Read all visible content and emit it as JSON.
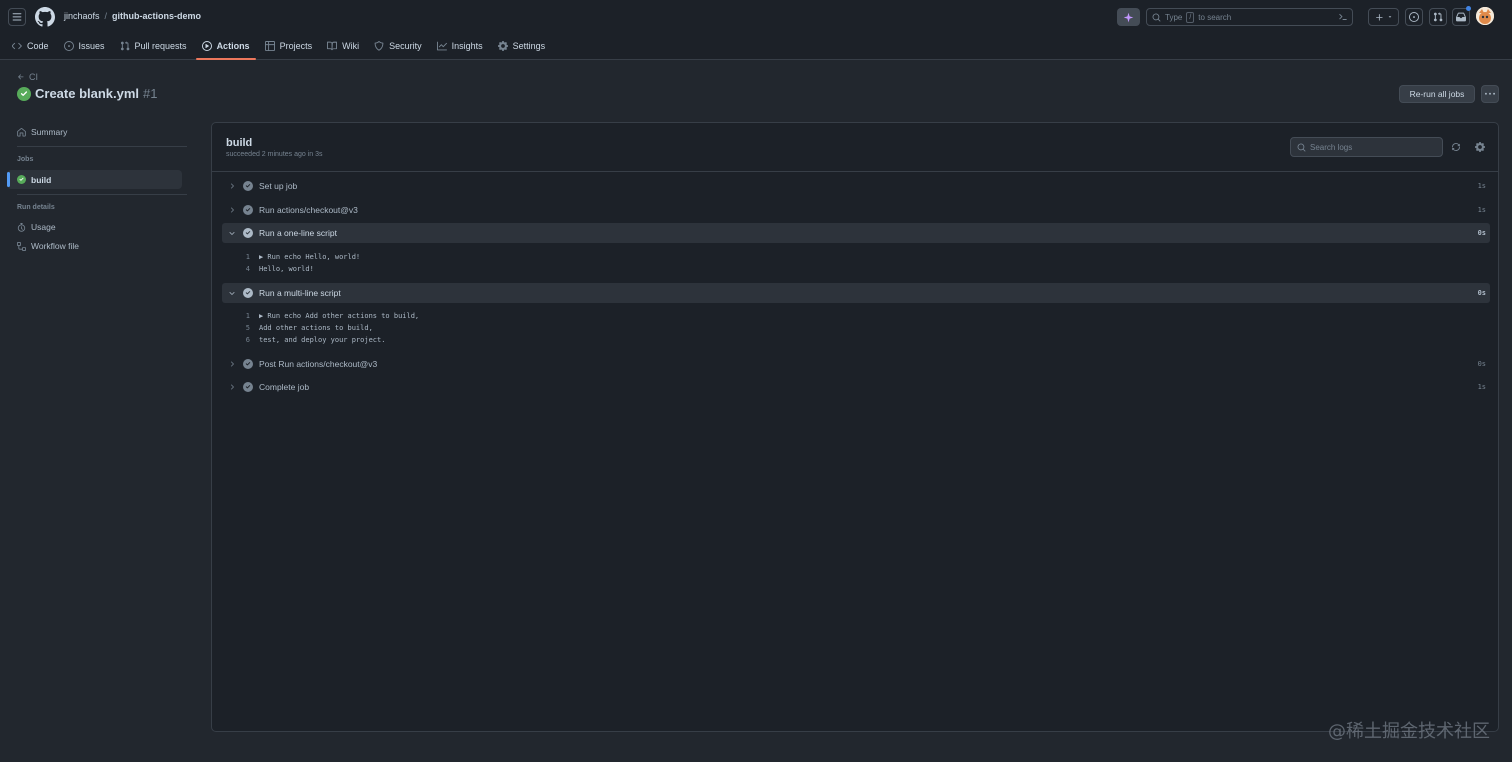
{
  "header": {
    "owner": "jinchaofs",
    "separator": "/",
    "repo": "github-actions-demo",
    "search": {
      "prefix": "Type",
      "key": "/",
      "suffix": "to search"
    }
  },
  "tabs": [
    {
      "label": "Code",
      "icon": "code-icon"
    },
    {
      "label": "Issues",
      "icon": "issue-icon"
    },
    {
      "label": "Pull requests",
      "icon": "pull-request-icon"
    },
    {
      "label": "Actions",
      "icon": "play-icon",
      "active": true
    },
    {
      "label": "Projects",
      "icon": "table-icon"
    },
    {
      "label": "Wiki",
      "icon": "book-icon"
    },
    {
      "label": "Security",
      "icon": "shield-icon"
    },
    {
      "label": "Insights",
      "icon": "graph-icon"
    },
    {
      "label": "Settings",
      "icon": "gear-icon"
    }
  ],
  "run": {
    "back_label": "CI",
    "title": "Create blank.yml",
    "number": "#1",
    "rerun_label": "Re-run all jobs"
  },
  "sidebar": {
    "summary": "Summary",
    "jobs_heading": "Jobs",
    "job": "build",
    "details_heading": "Run details",
    "usage": "Usage",
    "workflow_file": "Workflow file"
  },
  "job": {
    "name": "build",
    "subtitle": "succeeded 2 minutes ago in 3s",
    "search_placeholder": "Search logs"
  },
  "steps": [
    {
      "name": "Set up job",
      "duration": "1s",
      "expanded": false
    },
    {
      "name": "Run actions/checkout@v3",
      "duration": "1s",
      "expanded": false
    },
    {
      "name": "Run a one-line script",
      "duration": "0s",
      "expanded": true,
      "lines": [
        {
          "n": "1",
          "text": "▶ Run echo Hello, world!"
        },
        {
          "n": "4",
          "text": "Hello, world!"
        }
      ]
    },
    {
      "name": "Run a multi-line script",
      "duration": "0s",
      "expanded": true,
      "lines": [
        {
          "n": "1",
          "text": "▶ Run echo Add other actions to build,"
        },
        {
          "n": "5",
          "text": "Add other actions to build,"
        },
        {
          "n": "6",
          "text": "test, and deploy your project."
        }
      ]
    },
    {
      "name": "Post Run actions/checkout@v3",
      "duration": "0s",
      "expanded": false
    },
    {
      "name": "Complete job",
      "duration": "1s",
      "expanded": false
    }
  ],
  "watermark": "@稀土掘金技术社区",
  "colors": {
    "success": "#57ab5a",
    "active_tab": "#ec775c",
    "accent": "#539bf5"
  }
}
